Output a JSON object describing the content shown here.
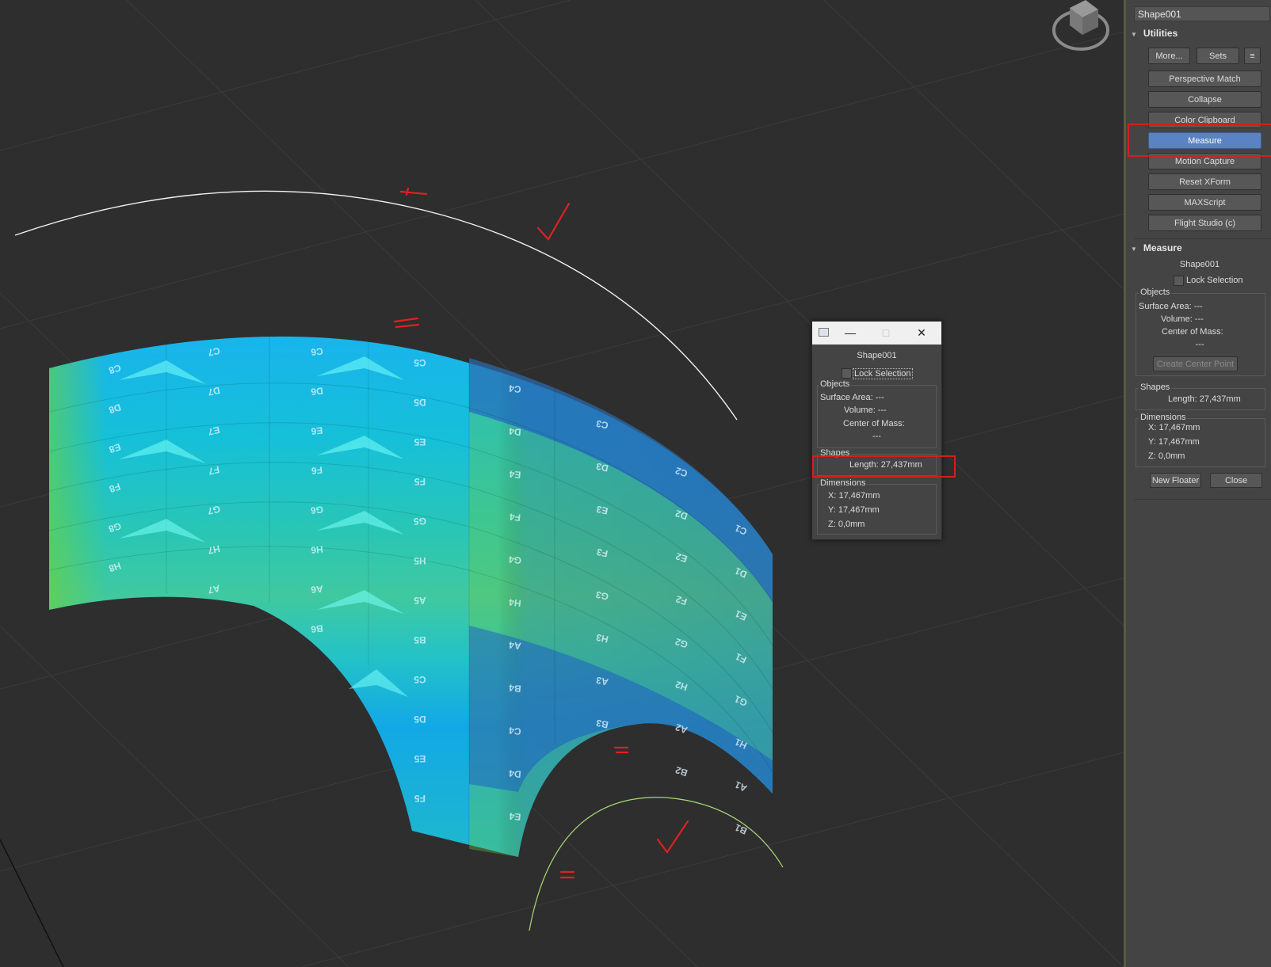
{
  "viewport": {
    "tile_rows": [
      [
        "C8",
        "C7",
        "C6",
        "C5",
        "C4",
        "C3",
        "C2",
        "C1"
      ],
      [
        "D8",
        "D7",
        "D6",
        "D5",
        "D4",
        "D3",
        "D2",
        "D1"
      ],
      [
        "E8",
        "E7",
        "E6",
        "E5",
        "E4",
        "E3",
        "E2",
        "E1"
      ],
      [
        "F8",
        "F7",
        "F6",
        "F5",
        "F4",
        "F3",
        "F2",
        "F1"
      ],
      [
        "G8",
        "G7",
        "G6",
        "G5",
        "G4",
        "G3",
        "G2",
        "G1"
      ],
      [
        "H8",
        "H7",
        "H6",
        "H5",
        "H4",
        "H3",
        "H2",
        "H1"
      ],
      [
        "",
        "A7",
        "A6",
        "A5",
        "A4",
        "A3",
        "A2",
        "A1"
      ],
      [
        "",
        "",
        "B6",
        "B5",
        "B4",
        "B3",
        "B2",
        "B1"
      ],
      [
        "",
        "",
        "",
        "C5",
        "C4",
        "",
        "",
        ""
      ],
      [
        "",
        "",
        "",
        "D5",
        "D4",
        "",
        "",
        ""
      ],
      [
        "",
        "",
        "",
        "E5",
        "E4",
        "",
        "",
        ""
      ],
      [
        "",
        "",
        "",
        "F5",
        "F4",
        "",
        "",
        ""
      ]
    ],
    "annotation_color": "#e02020"
  },
  "panel": {
    "object_name": "Shape001",
    "utilities": {
      "title": "Utilities",
      "more_label": "More...",
      "sets_label": "Sets",
      "buttons": [
        "Perspective Match",
        "Collapse",
        "Color Clipboard",
        "Measure",
        "Motion Capture",
        "Reset XForm",
        "MAXScript",
        "Flight Studio (c)"
      ],
      "active_button": "Measure"
    },
    "measure": {
      "title": "Measure",
      "object_name": "Shape001",
      "lock_label": "Lock Selection",
      "objects_label": "Objects",
      "surface_area": "Surface Area:  ---",
      "volume": "Volume:  ---",
      "center_of_mass": "Center of Mass:",
      "center_value": "---",
      "create_center_label": "Create Center Point",
      "shapes_label": "Shapes",
      "length": "Length:  27,437mm",
      "dimensions_label": "Dimensions",
      "x": "X:   17,467mm",
      "y": "Y:   17,467mm",
      "z": "Z:   0,0mm",
      "new_floater_label": "New Floater",
      "close_label": "Close"
    }
  },
  "floater": {
    "object_name": "Shape001",
    "lock_label": "Lock Selection",
    "objects_label": "Objects",
    "surface_area": "Surface Area:  ---",
    "volume": "Volume:  ---",
    "center_of_mass": "Center of Mass:",
    "center_value": "---",
    "shapes_label": "Shapes",
    "length": "Length:  27,437mm",
    "dimensions_label": "Dimensions",
    "x": "X:   17,467mm",
    "y": "Y:   17,467mm",
    "z": "Z:   0,0mm"
  },
  "colors": {
    "highlight_red": "#d21f1f",
    "active_blue": "#5b82c2"
  }
}
